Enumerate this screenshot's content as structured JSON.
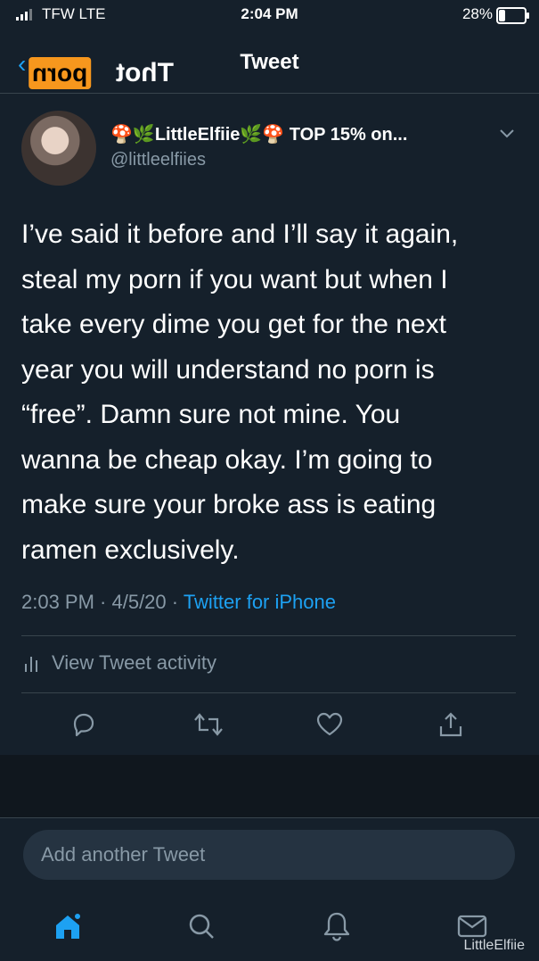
{
  "status_bar": {
    "carrier": "TFW  LTE",
    "time": "2:04 PM",
    "battery_percent": "28%",
    "battery_level": 0.28
  },
  "header": {
    "back_icon": "chevron-left-icon",
    "watermark_logo": "Thotporn",
    "title": "Tweet"
  },
  "tweet": {
    "display_name": "LittleElfiie",
    "name_suffix": "TOP 15% on...",
    "handle": "@littleelfiies",
    "text": "I’ve said it before and I’ll say it again,\nsteal my porn if you want but when I\ntake every dime you get for the next\nyear you will understand no porn is\n“free”. Damn sure not mine. You\nwanna be cheap okay. I’m going to\nmake sure your broke ass is eating\nramen exclusively.",
    "time": "2:03 PM · 4/5/20 · ",
    "source": "Twitter for iPhone",
    "activity_label": "View Tweet activity"
  },
  "actions": [
    "reply-icon",
    "retweet-icon",
    "like-icon",
    "share-icon"
  ],
  "compose": {
    "placeholder": "Add another Tweet"
  },
  "tabbar": [
    "home-icon",
    "search-icon",
    "notifications-icon",
    "messages-icon"
  ],
  "credit": "LittleElfiie",
  "colors": {
    "background": "#15202b",
    "accent": "#1da1f2",
    "secondary_text": "#8899a6",
    "divider": "#38444d"
  }
}
